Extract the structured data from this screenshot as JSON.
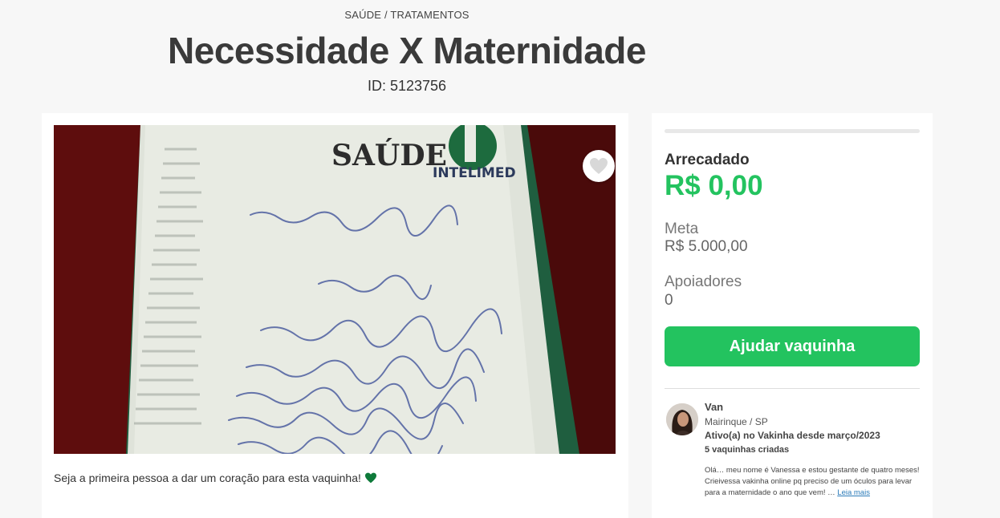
{
  "header": {
    "category": "SAÚDE / TRATAMENTOS",
    "title": "Necessidade X Maternidade",
    "campaign_id": "ID: 5123756"
  },
  "photo": {
    "logo_saude": "SAÚDE",
    "logo_intelimed": "INTELIMED",
    "favorite_icon": "heart-outline-icon"
  },
  "hearts": {
    "text": "Seja a primeira pessoa a dar um coração para esta vaquinha!",
    "icon": "green-heart-icon",
    "icon_color": "#0e7a3a"
  },
  "funding": {
    "progress_percent": 0,
    "raised_label": "Arrecadado",
    "raised_value": "R$ 0,00",
    "goal_label": "Meta",
    "goal_value": "R$ 5.000,00",
    "backers_label": "Apoiadores",
    "backers_value": "0",
    "cta_label": "Ajudar vaquinha",
    "accent_color": "#23c35f"
  },
  "owner": {
    "name": "Van",
    "location": "Mairinque / SP",
    "active_since": "Ativo(a) no Vakinha desde março/2023",
    "campaigns_created": "5 vaquinhas criadas",
    "bio": "Olá… meu nome é Vanessa e estou gestante de quatro meses! Crieivessa vakinha online pq preciso de um óculos para levar para a maternidade o ano que vem! …",
    "read_more": "Leia mais"
  }
}
